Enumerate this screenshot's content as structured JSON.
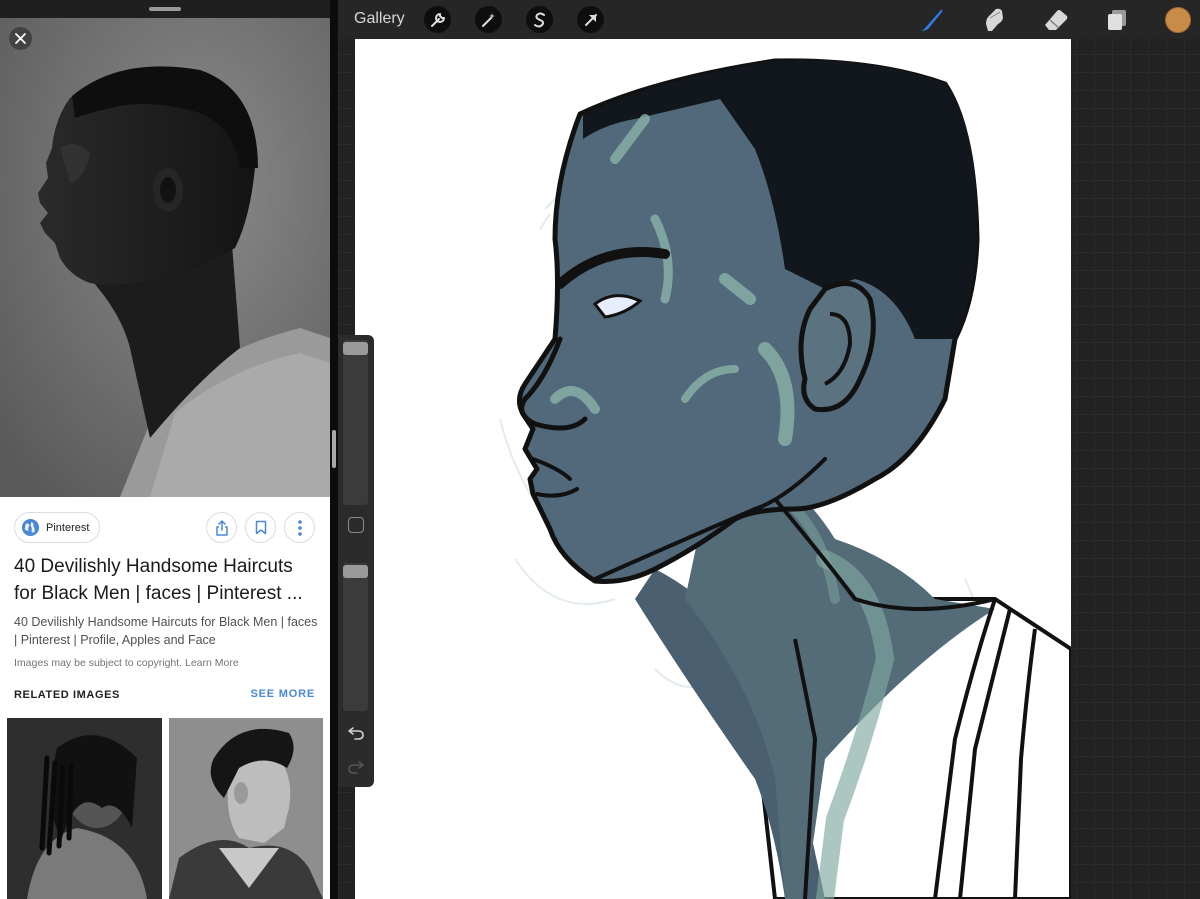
{
  "left_panel": {
    "source": {
      "label": "Pinterest",
      "icon": "globe-icon"
    },
    "actions": {
      "share_icon": "share-icon",
      "save_icon": "bookmark-icon",
      "more_icon": "more-vert-icon"
    },
    "result": {
      "title": "40 Devilishly Handsome Haircuts for Black Men | faces | Pinterest ...",
      "description": "40 Devilishly Handsome Haircuts for Black Men | faces | Pinterest | Profile, Apples and Face",
      "copyright_note": "Images may be subject to copyright. Learn More"
    },
    "related": {
      "label": "RELATED IMAGES",
      "see_more": "SEE MORE"
    }
  },
  "procreate": {
    "gallery_label": "Gallery",
    "tools": [
      "wrench-icon",
      "magic-wand-icon",
      "selection-s-icon",
      "transform-arrow-icon"
    ],
    "right_tools": [
      "brush-icon",
      "smudge-icon",
      "eraser-icon",
      "layers-icon"
    ],
    "active_tool": "brush",
    "current_color": "#c88b48",
    "brush_size_level": 0,
    "opacity_level": 0
  }
}
